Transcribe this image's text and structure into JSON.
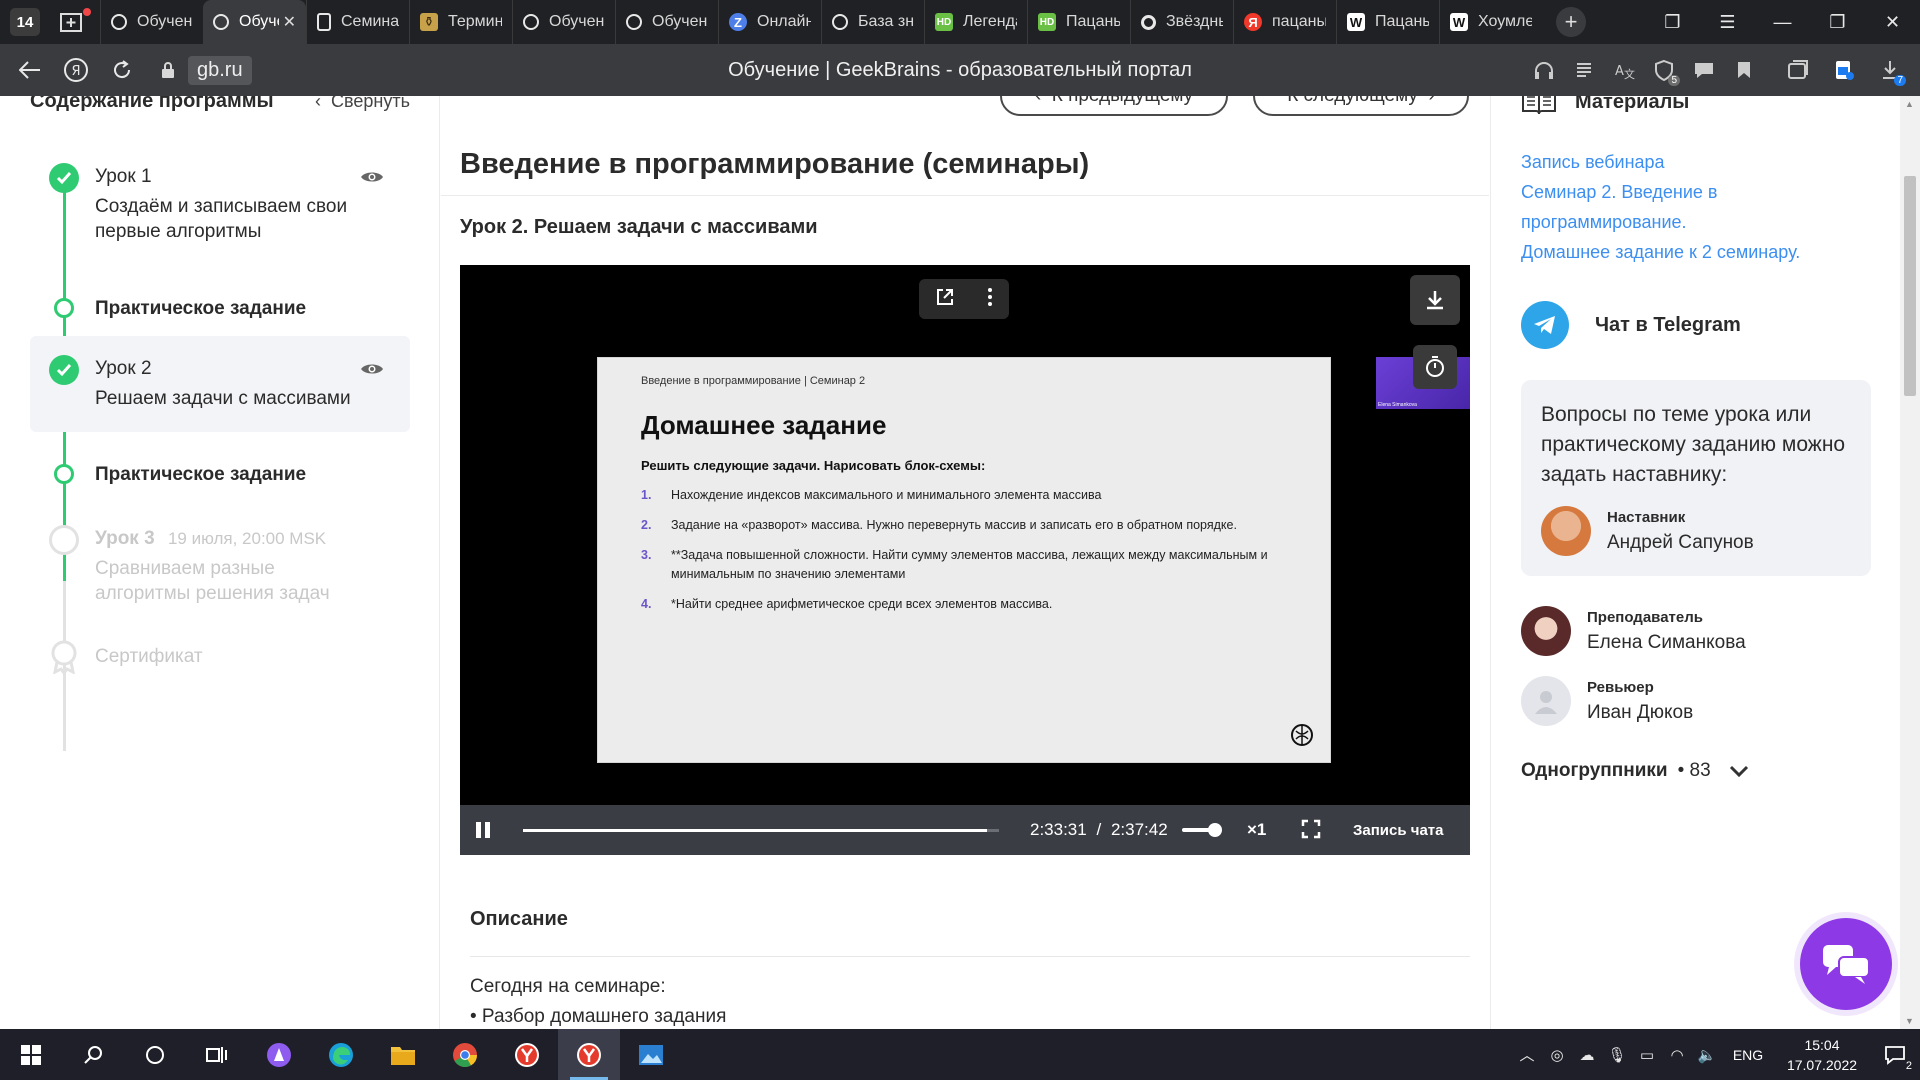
{
  "browser": {
    "tab_count": "14",
    "tabs": [
      {
        "label": "Обучение",
        "icon": "geekbrains-icon",
        "active": false
      },
      {
        "label": "Обучение",
        "icon": "geekbrains-icon",
        "active": true
      },
      {
        "label": "Семинар",
        "icon": "document-icon",
        "active": false
      },
      {
        "label": "Термин",
        "icon": "terminal-favicon",
        "active": false
      },
      {
        "label": "Обучение",
        "icon": "geekbrains-icon",
        "active": false
      },
      {
        "label": "Обучение",
        "icon": "geekbrains-icon",
        "active": false
      },
      {
        "label": "Онлайн",
        "icon": "online-favicon",
        "active": false
      },
      {
        "label": "База знаний",
        "icon": "geekbrains-icon",
        "active": false
      },
      {
        "label": "Легенда",
        "icon": "hd-favicon",
        "active": false
      },
      {
        "label": "Пацаны",
        "icon": "hd-favicon",
        "active": false
      },
      {
        "label": "Звёздный",
        "icon": "ring-favicon",
        "active": false
      },
      {
        "label": "пацаны",
        "icon": "yandex-favicon",
        "active": false
      },
      {
        "label": "Пацаны",
        "icon": "wikipedia-favicon",
        "active": false
      },
      {
        "label": "Хоумлендер",
        "icon": "wikipedia-favicon",
        "active": false
      }
    ],
    "url_domain": "gb.ru",
    "page_title": "Обучение | GeekBrains - образовательный портал",
    "badges": {
      "shield": "5",
      "downloads": "7"
    }
  },
  "sidebar": {
    "title": "Содержание программы",
    "collapse_label": "Свернуть",
    "lesson1": {
      "title": "Урок 1",
      "subtitle": "Создаём и записываем свои первые алгоритмы"
    },
    "practice1": "Практическое задание",
    "lesson2": {
      "title": "Урок 2",
      "subtitle": "Решаем задачи с массивами"
    },
    "practice2": "Практическое задание",
    "lesson3": {
      "title": "Урок 3",
      "date": "19 июля, 20:00 MSK",
      "subtitle": "Сравниваем разные алгоритмы решения задач"
    },
    "certificate": "Сертификат"
  },
  "main": {
    "prev_label": "К предыдущему",
    "next_label": "К следующему",
    "course_title": "Введение в программирование (семинары)",
    "lesson_heading": "Урок 2. Решаем задачи с массивами",
    "video": {
      "slide_crumb": "Введение в программирование | Семинар 2",
      "slide_title": "Домашнее задание",
      "slide_task": "Решить следующие задачи. Нарисовать блок-схемы:",
      "slide_items": [
        {
          "num": "1.",
          "text": "Нахождение индексов максимального и минимального элемента массива"
        },
        {
          "num": "2.",
          "text": "Задание на «разворот» массива. Нужно перевернуть массив и записать его в обратном порядке."
        },
        {
          "num": "3.",
          "text": "**Задача повышенной сложности. Найти сумму элементов массива, лежащих между максимальным и минимальным по значению элементами"
        },
        {
          "num": "4.",
          "text": "*Найти среднее арифметическое среди всех элементов массива."
        }
      ],
      "cam_name": "Elena Simankova",
      "current_time": "2:33:31",
      "separator": "/",
      "duration": "2:37:42",
      "progress": 0.974,
      "speed": "×1",
      "chat_record_label": "Запись чата"
    },
    "description_title": "Описание",
    "description_lines": [
      "Сегодня на семинаре:",
      "• Разбор домашнего задания"
    ]
  },
  "right": {
    "materials_title": "Материалы",
    "materials_links": [
      "Запись вебинара",
      "Семинар 2. Введение в",
      "программирование.",
      "Домашнее задание к 2 семинару."
    ],
    "telegram_label": "Чат в Telegram",
    "ask_text": "Вопросы по теме урока или практическому заданию можно задать наставнику:",
    "mentor": {
      "role": "Наставник",
      "name": "Андрей Сапунов"
    },
    "teacher": {
      "role": "Преподаватель",
      "name": "Елена Симанкова"
    },
    "reviewer": {
      "role": "Ревьюер",
      "name": "Иван Дюков"
    },
    "classmates_label": "Одногруппники",
    "classmates_count": "• 83"
  },
  "taskbar": {
    "lang": "ENG",
    "time": "15:04",
    "date": "17.07.2022",
    "notifications": "2"
  },
  "colors": {
    "accent_green": "#2fcb72",
    "link_blue": "#3c8ff0",
    "fab_purple": "#8d3ae6",
    "telegram_blue": "#2ea5e8"
  }
}
